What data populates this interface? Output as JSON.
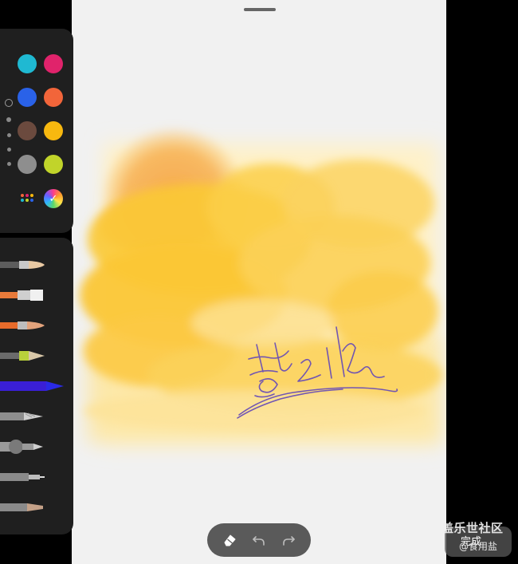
{
  "palette": {
    "colors": [
      {
        "name": "cyan",
        "hex": "#1fb9d2"
      },
      {
        "name": "magenta",
        "hex": "#e0236b"
      },
      {
        "name": "blue",
        "hex": "#2a62e8"
      },
      {
        "name": "orange",
        "hex": "#f2653a"
      },
      {
        "name": "brown",
        "hex": "#6b4a3e"
      },
      {
        "name": "amber",
        "hex": "#f7b80f"
      },
      {
        "name": "gray",
        "hex": "#8e8e8e"
      },
      {
        "name": "lime",
        "hex": "#c1d42a"
      }
    ],
    "selected_size_index": 0,
    "grid_icon": "color-grid-icon",
    "picker_icon": "color-picker-wheel-icon"
  },
  "brushes": [
    {
      "name": "round-watercolor-brush",
      "tip": "#e9c9a3",
      "body": "#5d5d5d"
    },
    {
      "name": "flat-watercolor-brush",
      "tip": "#f0f0f0",
      "body": "#e87a3a"
    },
    {
      "name": "oil-brush",
      "tip": "#e3a37c",
      "body": "#e76b2b"
    },
    {
      "name": "crayon",
      "tip": "#d8c7a8",
      "body": "#b9d13b"
    },
    {
      "name": "ballpoint-pen",
      "tip": "#2a2ae6",
      "body": "#3a1fd6",
      "selected": true
    },
    {
      "name": "pencil",
      "tip": "#cfcfcf",
      "body": "#8d8d8d"
    },
    {
      "name": "marker",
      "tip": "#cfcfcf",
      "body": "#9a9a9a"
    },
    {
      "name": "fineliner",
      "tip": "#bdbdbd",
      "body": "#8a8a8a"
    },
    {
      "name": "charcoal",
      "tip": "#c4a188",
      "body": "#8a8a8a"
    }
  ],
  "toolbar": {
    "eraser_icon": "eraser-icon",
    "undo_icon": "undo-icon",
    "redo_icon": "redo-icon",
    "done_label": "完成"
  },
  "watermark": {
    "title": "盖乐世社区",
    "author": "@食用盐"
  },
  "colors": {
    "panel": "#1f1f1f",
    "paper": "#f1f1f1",
    "ink": "#6a4fb6"
  }
}
